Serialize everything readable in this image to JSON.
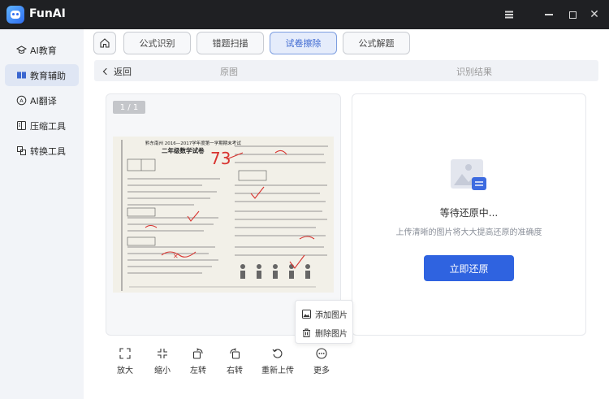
{
  "app": {
    "title": "FunAI"
  },
  "sidebar": {
    "items": [
      {
        "label": "AI教育",
        "icon": "graduation-cap-icon"
      },
      {
        "label": "教育辅助",
        "icon": "book-icon",
        "active": true
      },
      {
        "label": "AI翻译",
        "icon": "translate-icon"
      },
      {
        "label": "压缩工具",
        "icon": "compress-icon"
      },
      {
        "label": "转换工具",
        "icon": "convert-icon"
      }
    ]
  },
  "tabs": [
    {
      "label": "公式识别"
    },
    {
      "label": "错题扫描"
    },
    {
      "label": "试卷擦除",
      "active": true
    },
    {
      "label": "公式解题"
    }
  ],
  "subbar": {
    "back_label": "返回",
    "original_label": "原图",
    "result_label": "识别结果"
  },
  "preview": {
    "page_indicator": "1 / 1"
  },
  "result": {
    "waiting_text": "等待还原中...",
    "hint_text": "上传清晰的图片将大大提高还原的准确度",
    "restore_button": "立即还原"
  },
  "toolbar": [
    {
      "label": "放大",
      "icon": "zoom-in-icon"
    },
    {
      "label": "缩小",
      "icon": "zoom-out-icon"
    },
    {
      "label": "左转",
      "icon": "rotate-left-icon"
    },
    {
      "label": "右转",
      "icon": "rotate-right-icon"
    },
    {
      "label": "重新上传",
      "icon": "reupload-icon"
    },
    {
      "label": "更多",
      "icon": "more-icon"
    }
  ],
  "more_menu": [
    {
      "label": "添加图片",
      "icon": "add-image-icon"
    },
    {
      "label": "删除图片",
      "icon": "delete-image-icon"
    }
  ],
  "paper": {
    "header": "黔东南州 2016—2017学年度第一学期期末考试",
    "title": "二年级数学试卷",
    "score": "73"
  },
  "colors": {
    "accent": "#2f63e0",
    "titlebar": "#1f2023",
    "sidebar_active": "#dfe6f4",
    "ink_red": "#d8332f"
  }
}
